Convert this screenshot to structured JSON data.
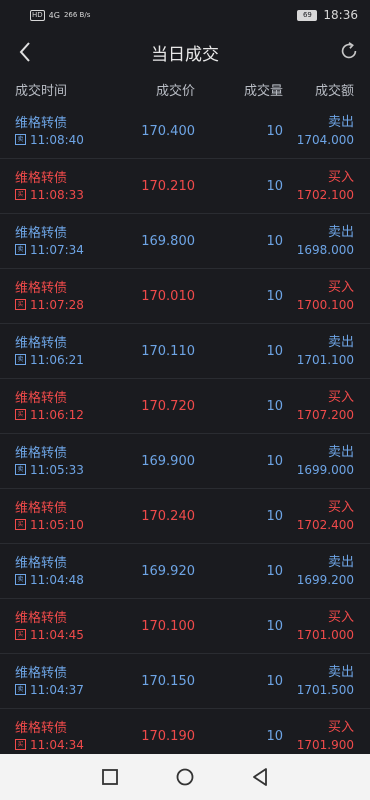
{
  "status": {
    "badge": "HD",
    "signal": "4G",
    "speed": "266 B/s",
    "battery": "69",
    "time": "18:36"
  },
  "nav": {
    "title": "当日成交"
  },
  "headers": {
    "time": "成交时间",
    "price": "成交价",
    "qty": "成交量",
    "amount": "成交额"
  },
  "rows": [
    {
      "name": "维格转债",
      "tag": "卖",
      "time": "11:08:40",
      "price": "170.400",
      "qty": "10",
      "side": "卖出",
      "amount": "1704.000",
      "type": "sell"
    },
    {
      "name": "维格转债",
      "tag": "买",
      "time": "11:08:33",
      "price": "170.210",
      "qty": "10",
      "side": "买入",
      "amount": "1702.100",
      "type": "buy"
    },
    {
      "name": "维格转债",
      "tag": "卖",
      "time": "11:07:34",
      "price": "169.800",
      "qty": "10",
      "side": "卖出",
      "amount": "1698.000",
      "type": "sell"
    },
    {
      "name": "维格转债",
      "tag": "买",
      "time": "11:07:28",
      "price": "170.010",
      "qty": "10",
      "side": "买入",
      "amount": "1700.100",
      "type": "buy"
    },
    {
      "name": "维格转债",
      "tag": "卖",
      "time": "11:06:21",
      "price": "170.110",
      "qty": "10",
      "side": "卖出",
      "amount": "1701.100",
      "type": "sell"
    },
    {
      "name": "维格转债",
      "tag": "买",
      "time": "11:06:12",
      "price": "170.720",
      "qty": "10",
      "side": "买入",
      "amount": "1707.200",
      "type": "buy"
    },
    {
      "name": "维格转债",
      "tag": "卖",
      "time": "11:05:33",
      "price": "169.900",
      "qty": "10",
      "side": "卖出",
      "amount": "1699.000",
      "type": "sell"
    },
    {
      "name": "维格转债",
      "tag": "买",
      "time": "11:05:10",
      "price": "170.240",
      "qty": "10",
      "side": "买入",
      "amount": "1702.400",
      "type": "buy"
    },
    {
      "name": "维格转债",
      "tag": "卖",
      "time": "11:04:48",
      "price": "169.920",
      "qty": "10",
      "side": "卖出",
      "amount": "1699.200",
      "type": "sell"
    },
    {
      "name": "维格转债",
      "tag": "买",
      "time": "11:04:45",
      "price": "170.100",
      "qty": "10",
      "side": "买入",
      "amount": "1701.000",
      "type": "buy"
    },
    {
      "name": "维格转债",
      "tag": "卖",
      "time": "11:04:37",
      "price": "170.150",
      "qty": "10",
      "side": "卖出",
      "amount": "1701.500",
      "type": "sell"
    },
    {
      "name": "维格转债",
      "tag": "买",
      "time": "11:04:34",
      "price": "170.190",
      "qty": "10",
      "side": "买入",
      "amount": "1701.900",
      "type": "buy"
    }
  ],
  "colors": {
    "buy": "#f04a4a",
    "sell": "#6ea5e6",
    "background": "#1a1b1f"
  }
}
